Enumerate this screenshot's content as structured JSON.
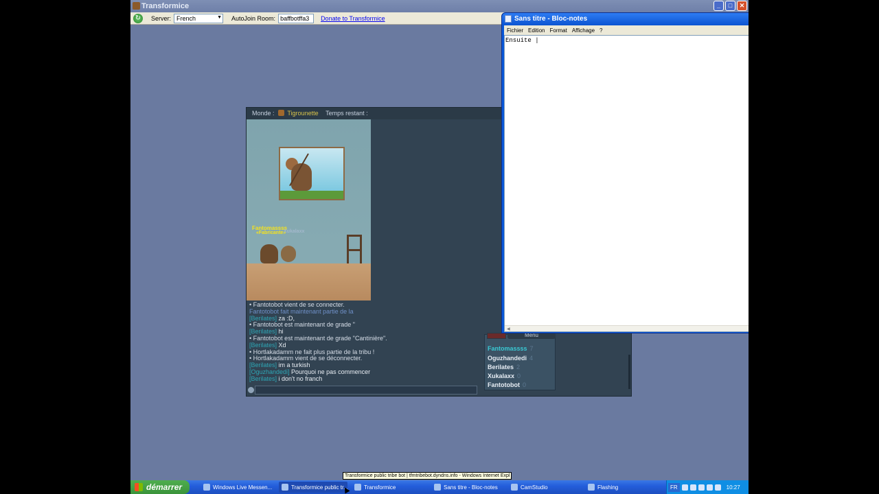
{
  "tfm_window": {
    "title": "Transformice",
    "toolbar": {
      "server_label": "Server:",
      "server_value": "French",
      "autojoin_label": "AutoJoin Room:",
      "room_value": "baffbotffa3",
      "donate_link": "Donate to Transformice"
    }
  },
  "game": {
    "topbar": {
      "world_label": "Monde :",
      "player_name": "Tigrounette",
      "time_label": "Temps restant :"
    },
    "name_tags": [
      "Fantomassss",
      "«Fabricante»",
      "Xukalaxx"
    ],
    "chat": [
      {
        "type": "sys",
        "text": "• Fantotobot vient de se connecter."
      },
      {
        "type": "sys-blue",
        "text": "Fantotobot fait maintenant partie de la"
      },
      {
        "type": "msg",
        "who": "[Berilates]",
        "text": " za :D,"
      },
      {
        "type": "sys",
        "text": "• Fantotobot est maintenant de grade \""
      },
      {
        "type": "msg",
        "who": "[Berilates]",
        "text": " hi"
      },
      {
        "type": "sys",
        "text": "• Fantotobot est maintenant de grade \"Cantinière\"."
      },
      {
        "type": "msg",
        "who": "[Berilates]",
        "text": " Xd"
      },
      {
        "type": "sys",
        "text": "• Hortlakadamm ne fait plus partie de la tribu !"
      },
      {
        "type": "sys",
        "text": "• Hortlakadamm vient de se déconnecter."
      },
      {
        "type": "msg",
        "who": "[Berilates]",
        "text": " im a turkish"
      },
      {
        "type": "msg",
        "who": "[Oguzhandedi]",
        "text": " Pourquoi ne pas commencer"
      },
      {
        "type": "msg",
        "who": "[Berilates]",
        "text": " i don't no franch"
      }
    ],
    "menu_label": "Menu",
    "players": [
      {
        "name": "Fantomassss",
        "score": "7",
        "highlight": true
      },
      {
        "name": "Oguzhandedi",
        "score": "4",
        "highlight": false
      },
      {
        "name": "Berilates",
        "score": "2",
        "highlight": false
      },
      {
        "name": "Xukalaxx",
        "score": "0",
        "highlight": false
      },
      {
        "name": "Fantotobot",
        "score": "0",
        "highlight": false
      }
    ]
  },
  "notepad": {
    "title": "Sans titre - Bloc-notes",
    "menus": [
      "Fichier",
      "Edition",
      "Format",
      "Affichage",
      "?"
    ],
    "content": "Ensuite |"
  },
  "tooltip": "Transformice public tribe bot | tfmtribebot.dyndns.info - Windows Internet Expl",
  "taskbar": {
    "start_label": "démarrer",
    "tasks": [
      {
        "label": "Windows Live Messen...",
        "active": false
      },
      {
        "label": "Transformice public tr...",
        "active": true
      },
      {
        "label": "Transformice",
        "active": false
      },
      {
        "label": "Sans titre - Bloc-notes",
        "active": false
      },
      {
        "label": "CamStudio",
        "active": false
      },
      {
        "label": "Flashing",
        "active": false
      }
    ],
    "lang": "FR",
    "clock": "10:27"
  }
}
